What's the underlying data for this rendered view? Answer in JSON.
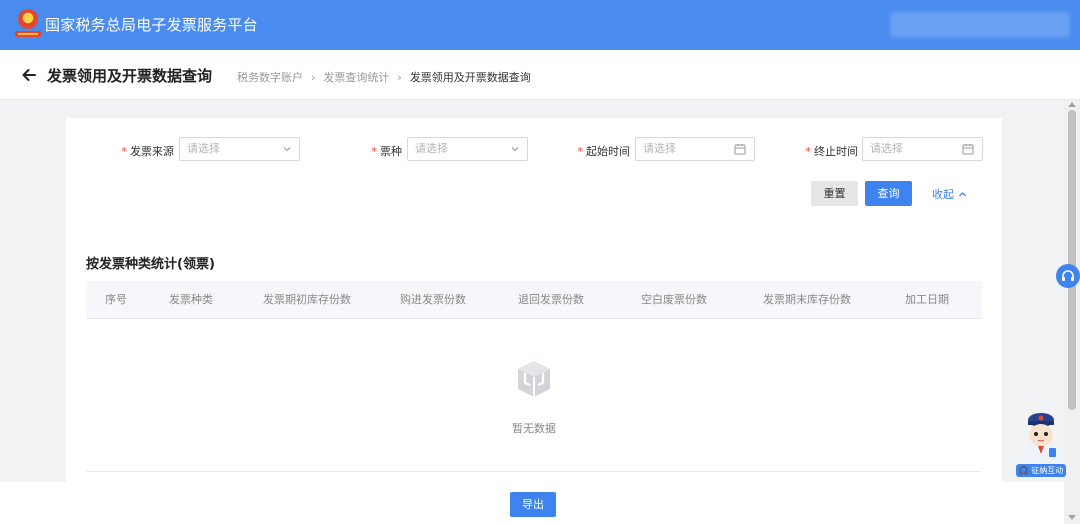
{
  "header": {
    "app_title": "国家税务总局电子发票服务平台",
    "logo_icon": "tax-emblem-icon",
    "brand_color": "#4a8cf0"
  },
  "page": {
    "title": "发票领用及开票数据查询",
    "breadcrumb": [
      "税务数字账户",
      "发票查询统计",
      "发票领用及开票数据查询"
    ]
  },
  "filters": {
    "source": {
      "label": "发票来源",
      "placeholder": "请选择"
    },
    "type": {
      "label": "票种",
      "placeholder": "请选择"
    },
    "start": {
      "label": "起始时间",
      "placeholder": "请选择"
    },
    "end": {
      "label": "终止时间",
      "placeholder": "请选择"
    },
    "reset_label": "重置",
    "query_label": "查询",
    "collapse_label": "收起"
  },
  "section": {
    "title": "按发票种类统计(领票)",
    "columns": [
      "序号",
      "发票种类",
      "发票期初库存份数",
      "购进发票份数",
      "退回发票份数",
      "空白废票份数",
      "发票期末库存份数",
      "加工日期"
    ],
    "empty_text": "暂无数据"
  },
  "footer": {
    "export_label": "导出"
  },
  "float": {
    "mascot_label": "征纳互动"
  },
  "colors": {
    "primary": "#3f83f0",
    "required": "#f0412f"
  }
}
